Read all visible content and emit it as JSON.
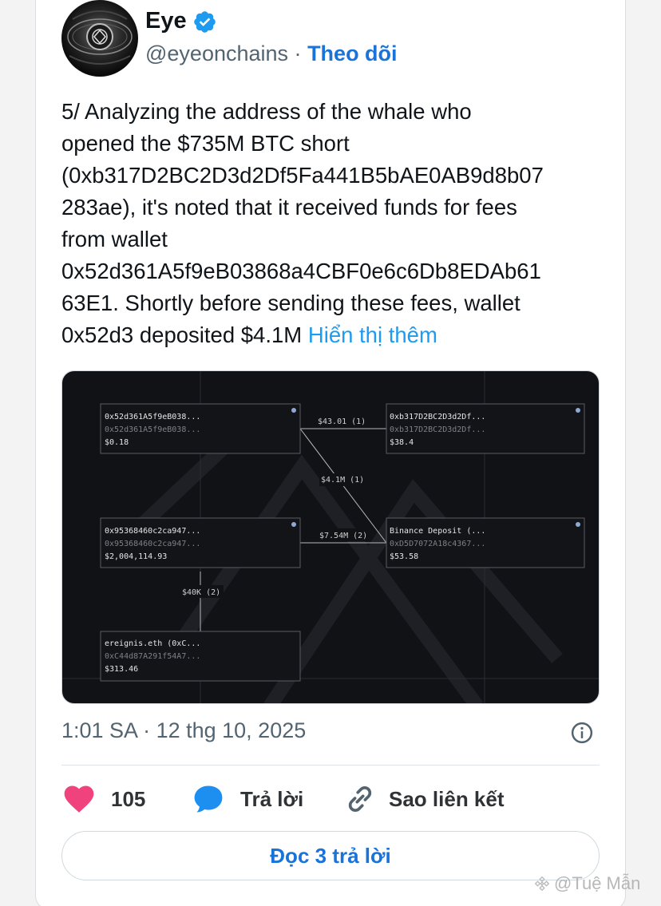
{
  "author": {
    "name": "Eye",
    "handle": "@eyeonchains",
    "separator": "·",
    "follow_label": "Theo dõi"
  },
  "tweet": {
    "lines": [
      "5/ Analyzing the address of the whale who",
      "opened the $735M BTC short",
      "(0xb317D2BC2D3d2Df5Fa441B5bAE0AB9d8b07",
      "283ae), it's noted that it received funds for fees",
      "from wallet",
      "0x52d361A5f9eB03868a4CBF0e6c6Db8EDAb61",
      "63E1. Shortly before sending these fees, wallet",
      "0x52d3 deposited $4.1M"
    ],
    "show_more": "Hiển thị thêm"
  },
  "graph": {
    "nodes": [
      {
        "title": "0x52d361A5f9eB038...",
        "sub": "0x52d361A5f9eB038...",
        "value": "$0.18"
      },
      {
        "title": "0xb317D2BC2D3d2Df...",
        "sub": "0xb317D2BC2D3d2Df...",
        "value": "$38.4"
      },
      {
        "title": "0x95368460c2ca947...",
        "sub": "0x95368460c2ca947...",
        "value": "$2,004,114.93"
      },
      {
        "title": "Binance Deposit (...",
        "sub": "0xD5D7072A18c4367...",
        "value": "$53.58"
      },
      {
        "title": "ereignis.eth (0xC...",
        "sub": "0xC44d87A291f54A7...",
        "value": "$313.46"
      }
    ],
    "edges": [
      {
        "label": "$43.01 (1)"
      },
      {
        "label": "$4.1M (1)"
      },
      {
        "label": "$7.54M (2)"
      },
      {
        "label": "$40K (2)"
      }
    ]
  },
  "timestamp": "1:01 SA · 12 thg 10, 2025",
  "actions": {
    "like_count": "105",
    "reply_label": "Trả lời",
    "copy_link_label": "Sao liên kết"
  },
  "read_replies_label": "Đọc 3 trả lời",
  "watermark": "@Tuệ Mẫn",
  "colors": {
    "accent": "#1a73d9",
    "like": "#f91880",
    "reply_icon": "#1d9bf0",
    "graph_bg": "#111216"
  },
  "icons": [
    "verified-badge-icon",
    "info-icon",
    "heart-icon",
    "reply-bubble-icon",
    "link-icon"
  ]
}
